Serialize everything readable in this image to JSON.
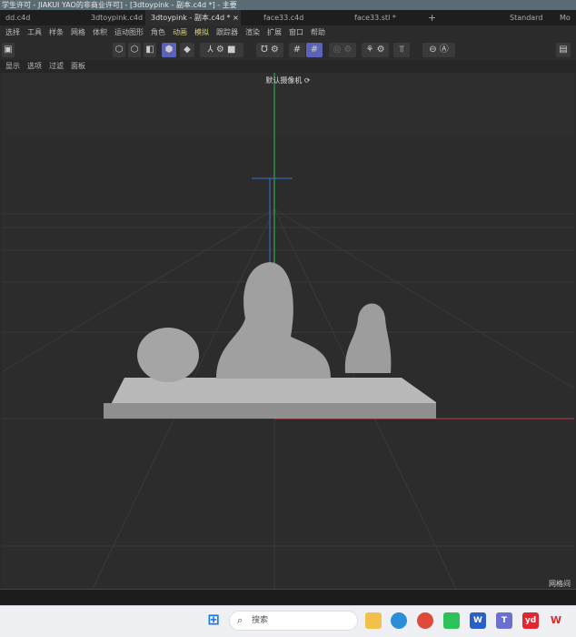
{
  "window_title": "学生许可 - JIAKUI YAO的非商业许可] - [3dtoypink - 副本.c4d *] - 主要",
  "tabs": [
    {
      "label": "dd.c4d"
    },
    {
      "label": "3dtoypink.c4d"
    },
    {
      "label": "3dtoypink - 副本.c4d *",
      "active": true
    },
    {
      "label": "face33.c4d"
    },
    {
      "label": "face33.stl *"
    },
    {
      "label": "+"
    },
    {
      "label": "Standard"
    },
    {
      "label": "Mo"
    }
  ],
  "menu": [
    "选择",
    "工具",
    "样条",
    "网格",
    "体积",
    "运动图形",
    "角色",
    "动画",
    "模拟",
    "跟踪器",
    "渲染",
    "扩展",
    "窗口",
    "帮助"
  ],
  "subpanel": [
    "显示",
    "选项",
    "过滤",
    "面板"
  ],
  "viewport": {
    "camera": "默认摄像机 ⟳",
    "grid_label": "网格间"
  },
  "taskbar": {
    "search_placeholder": "搜索",
    "apps": [
      "file-explorer",
      "edge",
      "chrome",
      "wechat",
      "word",
      "teams",
      "youdao",
      "wps"
    ]
  },
  "colors": {
    "accent": "#5a63b8",
    "y_axis": "#2fbf4a",
    "x_axis": "#c0393b",
    "z_axis": "#3a6fd8"
  }
}
